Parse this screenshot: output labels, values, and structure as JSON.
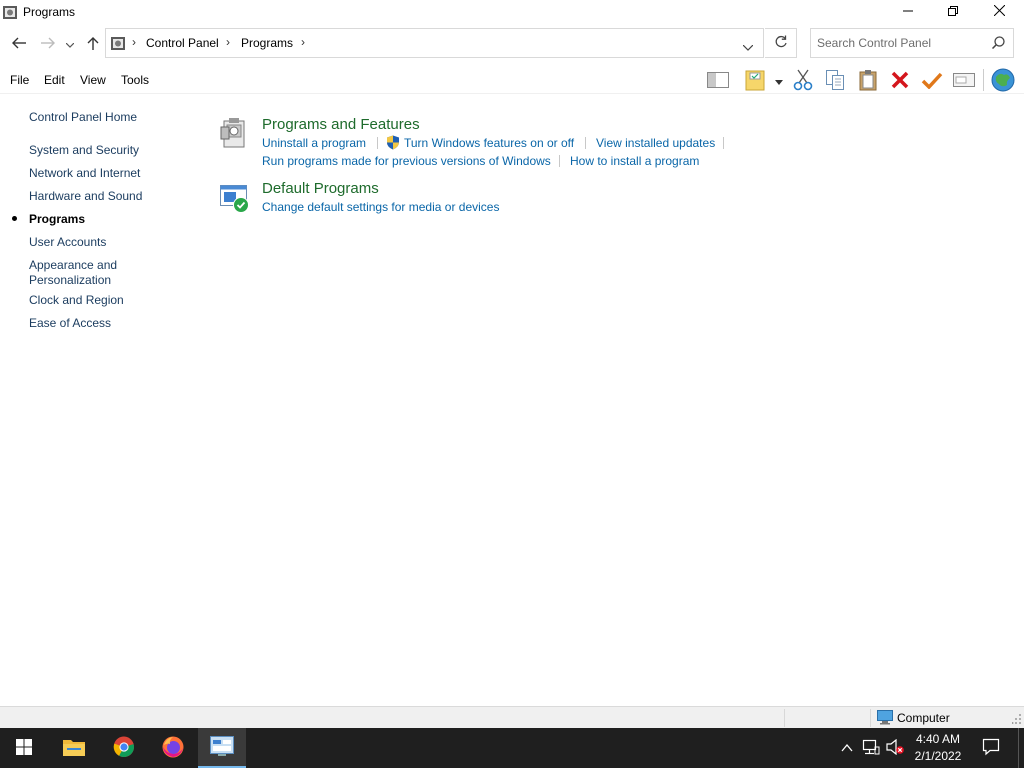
{
  "window": {
    "title": "Programs",
    "minimize_icon": "minimize-icon",
    "maximize_icon": "restore-icon",
    "close_icon": "close-icon"
  },
  "address": {
    "breadcrumbs": [
      "Control Panel",
      "Programs"
    ],
    "search_placeholder": "Search Control Panel"
  },
  "menu": {
    "items": [
      "File",
      "Edit",
      "View",
      "Tools"
    ]
  },
  "toolbar": {
    "icons": [
      "layout-pane-icon",
      "properties-folder-icon",
      "dropdown-arrow-icon",
      "cut-icon",
      "copy-icon",
      "paste-icon",
      "delete-icon",
      "checkmark-icon",
      "rename-icon",
      "globe-icon"
    ]
  },
  "leftnav": {
    "home": "Control Panel Home",
    "items": [
      "System and Security",
      "Network and Internet",
      "Hardware and Sound",
      "Programs",
      "User Accounts",
      "Appearance and",
      "Personalization",
      "Clock and Region",
      "Ease of Access"
    ],
    "current": "Programs"
  },
  "content": {
    "programs_features": {
      "title": "Programs and Features",
      "links": [
        "Uninstall a program",
        "Turn Windows features on or off",
        "View installed updates",
        "Run programs made for previous versions of Windows",
        "How to install a program"
      ]
    },
    "default_programs": {
      "title": "Default Programs",
      "links": [
        "Change default settings for media or devices"
      ]
    }
  },
  "status": {
    "computer_label": "Computer"
  },
  "taskbar": {
    "clock_time": "4:40 AM",
    "clock_date": "2/1/2022"
  },
  "colors": {
    "category_title": "#1e6b2c",
    "link": "#0a66a8",
    "nav_link": "#1a3b5e",
    "taskbar": "#1f1f1f"
  }
}
